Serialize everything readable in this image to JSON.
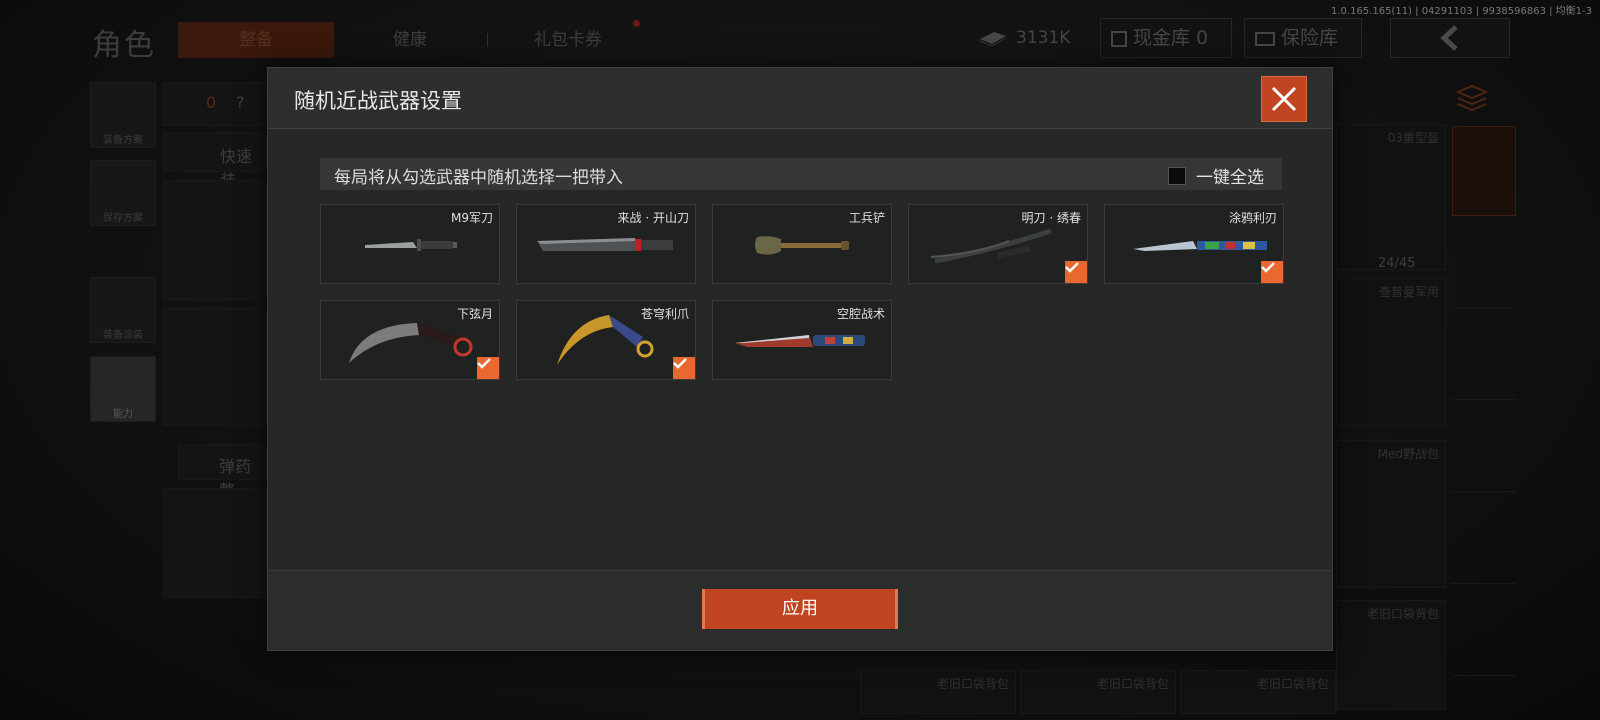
{
  "version_info": "1.0.165.165(11) | 04291103 | 9938596863 | 均衡1-3",
  "background": {
    "page_title": "角色",
    "tabs": [
      {
        "label": "整备",
        "active": true
      },
      {
        "label": "健康",
        "active": false
      },
      {
        "label": "礼包卡券",
        "active": false,
        "notification_dot": true
      }
    ],
    "currency_amount": "3131K",
    "cash_vault_label": "现金库 0",
    "insurance_label": "保险库",
    "left_panel": {
      "armor_count": "0",
      "help_glyph": "?",
      "quick_equip_label": "快速装",
      "buttons": [
        "装备方案",
        "保存方案",
        "装备涂装",
        "能力"
      ],
      "ammo_label": "弹药整"
    },
    "right_panel": {
      "helmet_label": "03重型盔",
      "capacity": "24/45",
      "items": [
        "查普曼军用",
        "Med野战包",
        "老旧口袋背包",
        "老旧口袋背包",
        "老旧口袋背包",
        "老旧口袋背包"
      ]
    }
  },
  "modal": {
    "title": "随机近战武器设置",
    "description": "每局将从勾选武器中随机选择一把带入",
    "select_all_label": "一键全选",
    "select_all_checked": false,
    "apply_label": "应用",
    "weapons": [
      {
        "name": "M9军刀",
        "checked": false,
        "icon": "combat-knife-icon"
      },
      {
        "name": "来战 · 开山刀",
        "checked": false,
        "icon": "machete-icon"
      },
      {
        "name": "工兵铲",
        "checked": false,
        "icon": "shovel-icon"
      },
      {
        "name": "明刀 · 绣春",
        "checked": true,
        "icon": "curved-saber-icon"
      },
      {
        "name": "涂鸦利刃",
        "checked": true,
        "icon": "graffiti-blade-icon"
      },
      {
        "name": "下弦月",
        "checked": true,
        "icon": "karambit-icon"
      },
      {
        "name": "苍穹利爪",
        "checked": true,
        "icon": "gold-karambit-icon"
      },
      {
        "name": "空腔战术",
        "checked": false,
        "icon": "tactical-knife-icon"
      }
    ]
  },
  "colors": {
    "accent": "#c0441f",
    "checkbox": "#e8682f",
    "modal_bg": "#262727"
  }
}
